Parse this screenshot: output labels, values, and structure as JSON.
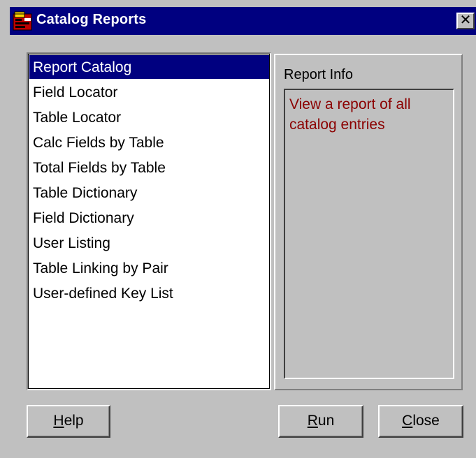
{
  "window": {
    "title": "Catalog Reports",
    "close_glyph": "✕"
  },
  "reports": {
    "items": [
      {
        "label": "Report Catalog",
        "selected": true
      },
      {
        "label": "Field Locator"
      },
      {
        "label": "Table Locator"
      },
      {
        "label": "Calc Fields by Table"
      },
      {
        "label": "Total Fields by Table"
      },
      {
        "label": "Table Dictionary"
      },
      {
        "label": "Field Dictionary"
      },
      {
        "label": "User Listing"
      },
      {
        "label": "Table Linking by Pair"
      },
      {
        "label": "User-defined Key List"
      }
    ]
  },
  "info": {
    "label": "Report Info",
    "text": "View a report of all catalog entries",
    "text_color": "#8b0000"
  },
  "buttons": {
    "help": {
      "accel": "H",
      "rest": "elp"
    },
    "run": {
      "accel": "R",
      "rest": "un"
    },
    "close": {
      "accel": "C",
      "rest": "lose"
    }
  },
  "colors": {
    "titlebar": "#000080",
    "face": "#c0c0c0",
    "selection": "#000080"
  },
  "icons": {
    "app": "app-icon",
    "close": "close-icon"
  }
}
